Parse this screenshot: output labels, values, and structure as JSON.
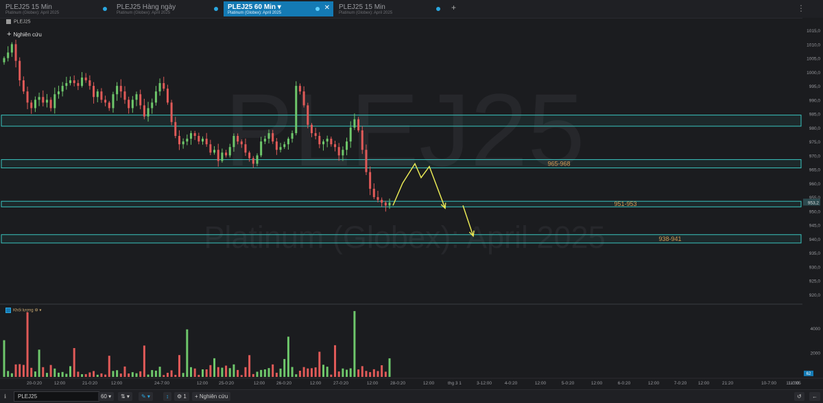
{
  "tabs": [
    {
      "title": "PLEJ25 15 Min",
      "subtitle": "Platinum (Globex): April 2025",
      "active": false
    },
    {
      "title": "PLEJ25 Hàng ngày",
      "subtitle": "Platinum (Globex): April 2025",
      "active": false
    },
    {
      "title": "PLEJ25 60 Min",
      "subtitle": "Platinum (Globex): April 2025",
      "active": true
    },
    {
      "title": "PLEJ25 15 Min",
      "subtitle": "Platinum (Globex): April 2025",
      "active": false
    }
  ],
  "legend": {
    "symbol": "PLEJ25",
    "research_label": "Nghiên cứu"
  },
  "watermark": {
    "symbol": "PLEJ25",
    "name": "Platinum (Globex): April 2025"
  },
  "colors": {
    "up": "#6ec76b",
    "down": "#e05a58",
    "zone": "#3ac6c0",
    "arrow": "#e8e855",
    "zone_label": "#d69a52"
  },
  "chart_data": {
    "type": "candlestick",
    "ylim": [
      917,
      1017
    ],
    "price_ticks": [
      "1015,0",
      "1010,0",
      "1005,0",
      "1000,0",
      "995,0",
      "990,0",
      "985,0",
      "980,0",
      "975,0",
      "970,0",
      "965,0",
      "960,0",
      "955,0",
      "950,0",
      "945,0",
      "940,0",
      "935,0",
      "930,0",
      "925,0",
      "920,0"
    ],
    "current_price": "953,2",
    "zones": [
      {
        "low": 980.5,
        "high": 984.5,
        "label": ""
      },
      {
        "low": 965.5,
        "high": 968.5,
        "label": "965-968"
      },
      {
        "low": 951.5,
        "high": 953.5,
        "label": "951-953"
      },
      {
        "low": 938.5,
        "high": 941.5,
        "label": "938-941"
      }
    ],
    "projection": [
      [
        573,
        952
      ],
      [
        587,
        960
      ],
      [
        605,
        967
      ],
      [
        614,
        962
      ],
      [
        626,
        966
      ],
      [
        649,
        951
      ]
    ],
    "projection2": [
      [
        675,
        952
      ],
      [
        690,
        941
      ]
    ],
    "close_path": [
      1005,
      1007,
      1010,
      1004,
      997,
      993,
      989,
      987,
      990,
      991,
      989,
      990,
      987,
      992,
      993,
      995,
      996,
      997,
      996,
      995,
      998,
      997,
      995,
      991,
      993,
      990,
      989,
      987,
      992,
      995,
      993,
      990,
      987,
      990,
      992,
      988,
      984,
      987,
      989,
      993,
      996,
      994,
      989,
      982,
      977,
      974,
      975,
      976,
      978,
      977,
      975,
      976,
      974,
      971,
      972,
      968,
      971,
      970,
      973,
      977,
      975,
      974,
      971,
      969,
      967,
      970,
      975,
      976,
      978,
      975,
      972,
      973,
      974,
      976,
      978,
      995,
      993,
      988,
      981,
      978,
      977,
      974,
      975,
      976,
      974,
      973,
      970,
      972,
      975,
      980,
      983,
      979,
      972,
      964,
      958,
      955,
      954,
      953,
      952,
      953
    ],
    "volume": {
      "ylim": [
        0,
        5800
      ],
      "ticks": [
        "4000",
        "2000"
      ],
      "current": "62"
    },
    "x_ticks": [
      "20-0:20",
      "12:00",
      "21-0:20",
      "12:00",
      "24-7:00",
      "12:00",
      "25-0:20",
      "12:00",
      "26-0:20",
      "12:00",
      "27-0:20",
      "12:00",
      "28-0:20",
      "12:00",
      "thg 3 1",
      "3-12:00",
      "4-0:20",
      "12:00",
      "5-0:20",
      "12:00",
      "6-0:20",
      "12:00",
      "7-0:20",
      "12:00",
      "21:20",
      "10-7:00",
      "11-0:05",
      "11:00"
    ]
  },
  "volume_pane": {
    "label": "Khối lượng"
  },
  "bottom": {
    "symbol": "PLEJ25",
    "interval": "60",
    "study_count": "1",
    "research_label": "Nghiên cứu"
  }
}
